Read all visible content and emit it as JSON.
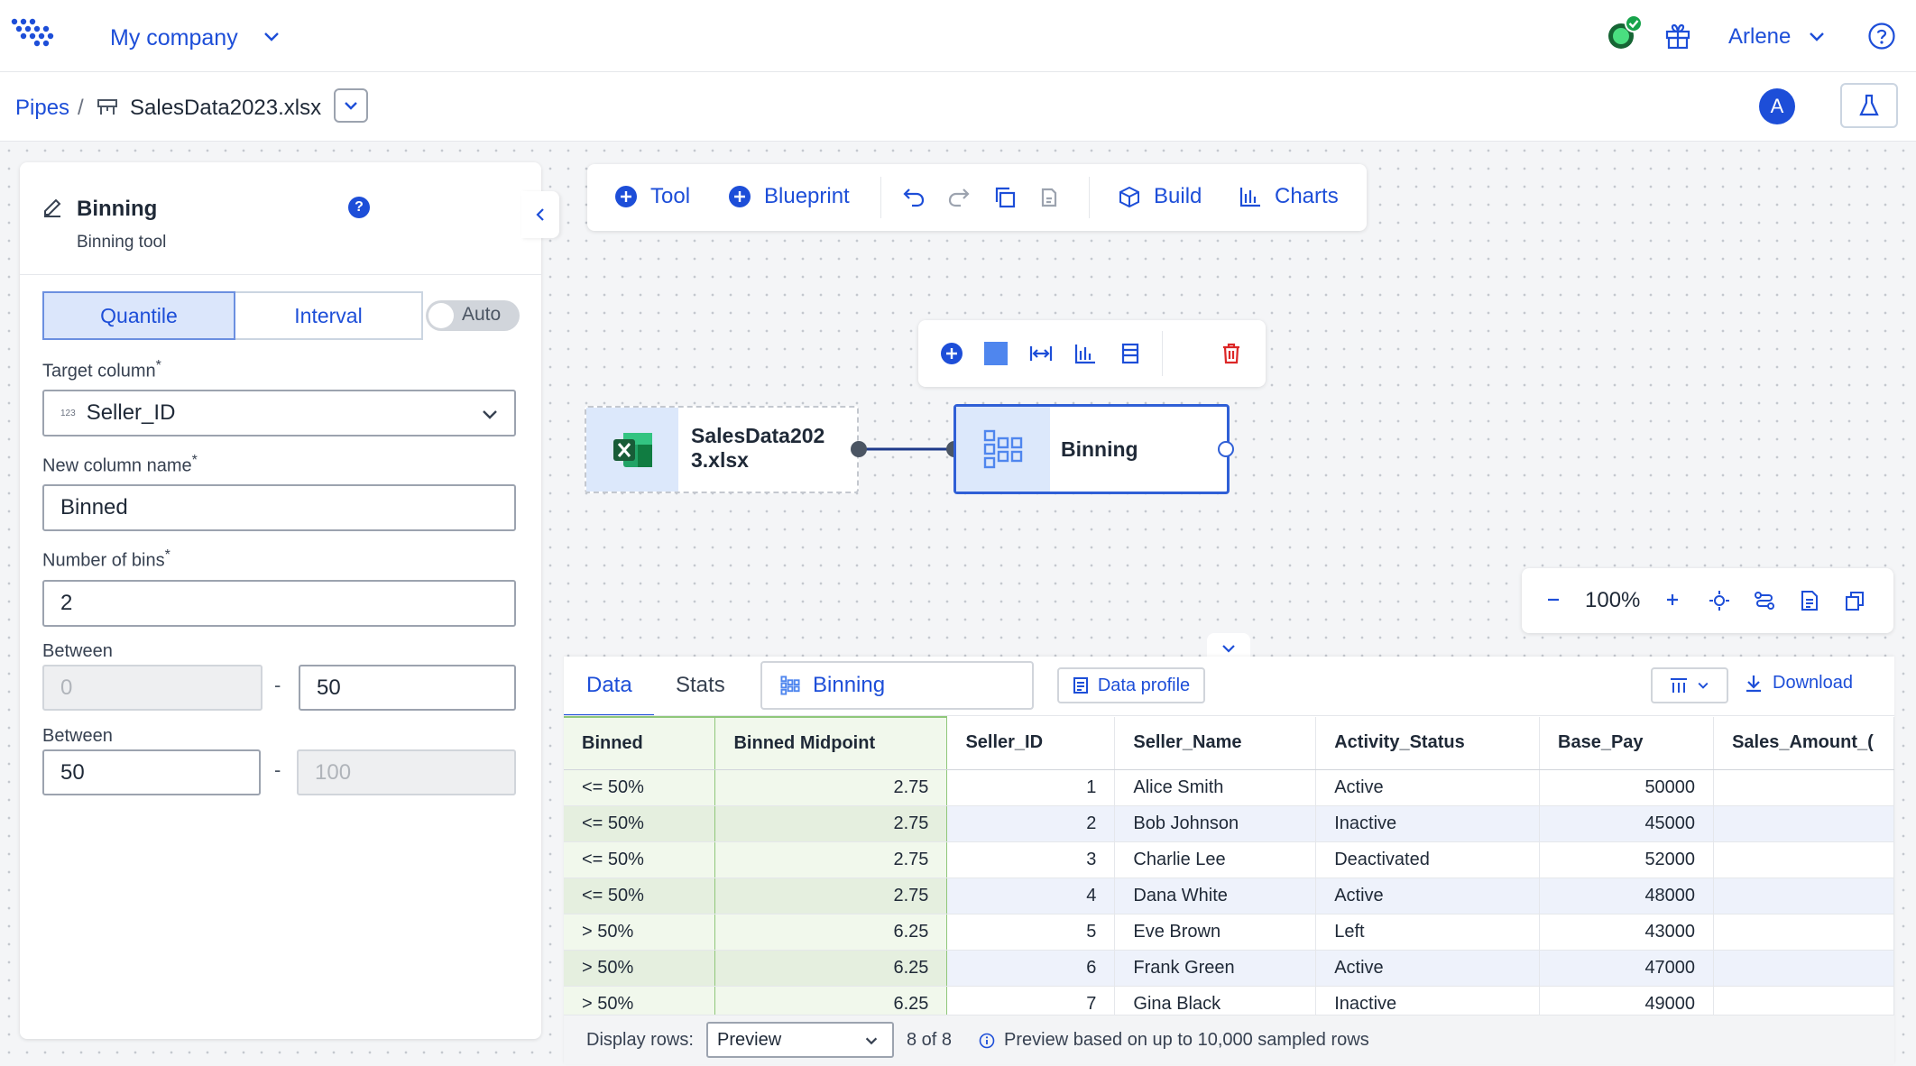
{
  "header": {
    "company": "My company",
    "user": "Arlene"
  },
  "breadcrumb": {
    "root": "Pipes",
    "separator": "/",
    "file": "SalesData2023.xlsx",
    "avatar": "A"
  },
  "panel": {
    "title": "Binning",
    "subtitle": "Binning tool",
    "mode_quantile": "Quantile",
    "mode_interval": "Interval",
    "auto_label": "Auto",
    "target_column_label": "Target column",
    "target_column_value": "Seller_ID",
    "target_column_type": "123",
    "new_column_label": "New column name",
    "new_column_value": "Binned",
    "bins_label": "Number of bins",
    "bins_value": "2",
    "required_mark": "*",
    "ranges": [
      {
        "label": "Between",
        "from": "0",
        "to": "50",
        "dash": "-"
      },
      {
        "label": "Between",
        "from": "50",
        "to": "100",
        "dash": "-"
      }
    ]
  },
  "toolbar": {
    "tool": "Tool",
    "blueprint": "Blueprint",
    "build": "Build",
    "charts": "Charts"
  },
  "nodes": {
    "source_line1": "SalesData202",
    "source_line2": "3.xlsx",
    "binning": "Binning"
  },
  "zoom": {
    "level": "100%"
  },
  "data_panel": {
    "tab_data": "Data",
    "tab_stats": "Stats",
    "step_name": "Binning",
    "data_profile": "Data profile",
    "download": "Download",
    "columns": [
      "Binned",
      "Binned Midpoint",
      "Seller_ID",
      "Seller_Name",
      "Activity_Status",
      "Base_Pay",
      "Sales_Amount_("
    ],
    "rows": [
      [
        "<= 50%",
        "2.75",
        "1",
        "Alice Smith",
        "Active",
        "50000"
      ],
      [
        "<= 50%",
        "2.75",
        "2",
        "Bob Johnson",
        "Inactive",
        "45000"
      ],
      [
        "<= 50%",
        "2.75",
        "3",
        "Charlie Lee",
        "Deactivated",
        "52000"
      ],
      [
        "<= 50%",
        "2.75",
        "4",
        "Dana White",
        "Active",
        "48000"
      ],
      [
        "> 50%",
        "6.25",
        "5",
        "Eve Brown",
        "Left",
        "43000"
      ],
      [
        "> 50%",
        "6.25",
        "6",
        "Frank Green",
        "Active",
        "47000"
      ],
      [
        "> 50%",
        "6.25",
        "7",
        "Gina Black",
        "Inactive",
        "49000"
      ]
    ],
    "display_rows_label": "Display rows:",
    "display_rows_value": "Preview",
    "row_count": "8 of 8",
    "preview_note": "Preview based on up to 10,000 sampled rows"
  },
  "colors": {
    "accent": "#1d4ed8",
    "highlight_column": "#f1f8ec",
    "delete": "#dc2626",
    "excel_green": "#1d6f42"
  }
}
